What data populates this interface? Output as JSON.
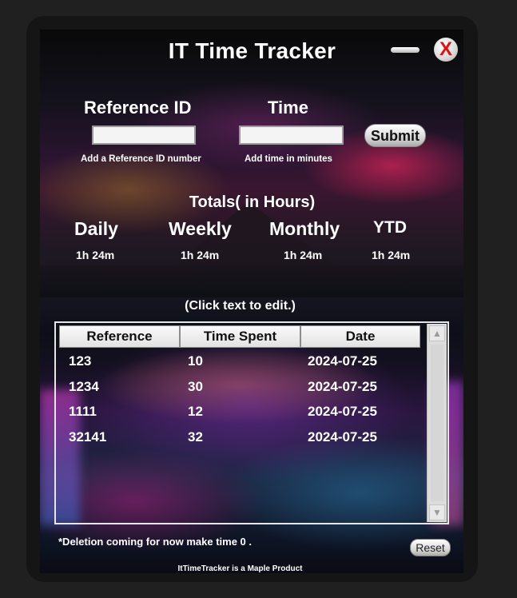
{
  "window": {
    "title": "IT Time Tracker",
    "minimize_icon": "minimize-bar-icon",
    "close_label": "X",
    "close_color": "#e01010"
  },
  "form": {
    "reference": {
      "label": "Reference  ID",
      "value": "",
      "hint": "Add a Reference ID number"
    },
    "time": {
      "label": "Time",
      "value": "",
      "hint": "Add time in minutes"
    },
    "submit_label": "Submit"
  },
  "totals": {
    "title": "Totals( in Hours)",
    "periods": [
      {
        "label": "Daily",
        "value": "1h 24m"
      },
      {
        "label": "Weekly",
        "value": "1h 24m"
      },
      {
        "label": "Monthly",
        "value": "1h 24m"
      },
      {
        "label": "YTD",
        "value": "1h 24m"
      }
    ]
  },
  "table": {
    "edit_hint": "(Click text to edit.)",
    "columns": [
      "Reference",
      "Time Spent",
      "Date"
    ],
    "rows": [
      [
        "123",
        "10",
        "2024-07-25"
      ],
      [
        "1234",
        "30",
        "2024-07-25"
      ],
      [
        "1111",
        "12",
        "2024-07-25"
      ],
      [
        "32141",
        "32",
        "2024-07-25"
      ]
    ],
    "scroll_up_icon": "▲",
    "scroll_down_icon": "▼"
  },
  "footer": {
    "note": "*Deletion coming for now make time 0 .",
    "reset_label": "Reset",
    "credit": "ItTimeTracker is a Maple Product"
  }
}
